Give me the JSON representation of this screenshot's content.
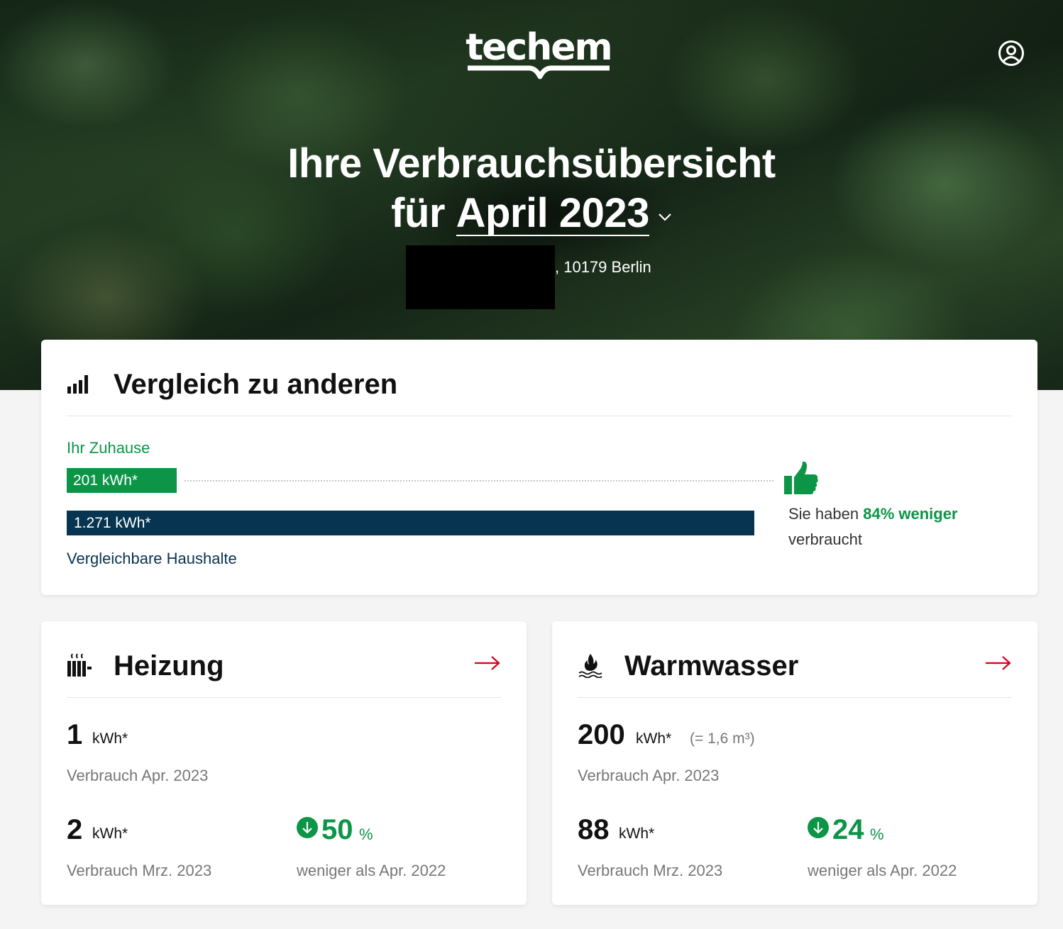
{
  "brand": {
    "logo": "techem"
  },
  "header": {
    "user_icon": "user-circle-icon",
    "title_line1": "Ihre Verbrauchsübersicht",
    "title_prefix": "für",
    "period": "April 2023",
    "address": ", 10179 Berlin"
  },
  "compare": {
    "title": "Vergleich zu anderen",
    "icon": "signal-bars-icon",
    "home_label": "Ihr Zuhause",
    "home_value": "201 kWh*",
    "avg_value": "1.271 kWh*",
    "avg_label": "Vergleichbare Haushalte",
    "result_prefix": "Sie haben",
    "result_highlight": "84% weniger",
    "result_suffix": "verbraucht",
    "colors": {
      "home": "#0c9447",
      "average": "#073450"
    }
  },
  "heating": {
    "title": "Heizung",
    "icon": "radiator-icon",
    "current_value": "1",
    "current_unit": "kWh*",
    "current_label": "Verbrauch Apr. 2023",
    "prev_value": "2",
    "prev_unit": "kWh*",
    "prev_label": "Verbrauch Mrz. 2023",
    "change_value": "50",
    "change_unit": "%",
    "change_label": "weniger als Apr. 2022"
  },
  "water": {
    "title": "Warmwasser",
    "icon": "flame-water-icon",
    "current_value": "200",
    "current_unit": "kWh*",
    "current_conversion": "(= 1,6 m³)",
    "current_label": "Verbrauch Apr. 2023",
    "prev_value": "88",
    "prev_unit": "kWh*",
    "prev_label": "Verbrauch Mrz. 2023",
    "change_value": "24",
    "change_unit": "%",
    "change_label": "weniger als Apr. 2022"
  },
  "colors": {
    "accent_green": "#0c9447",
    "accent_red": "#d0021b",
    "navy": "#073450"
  }
}
